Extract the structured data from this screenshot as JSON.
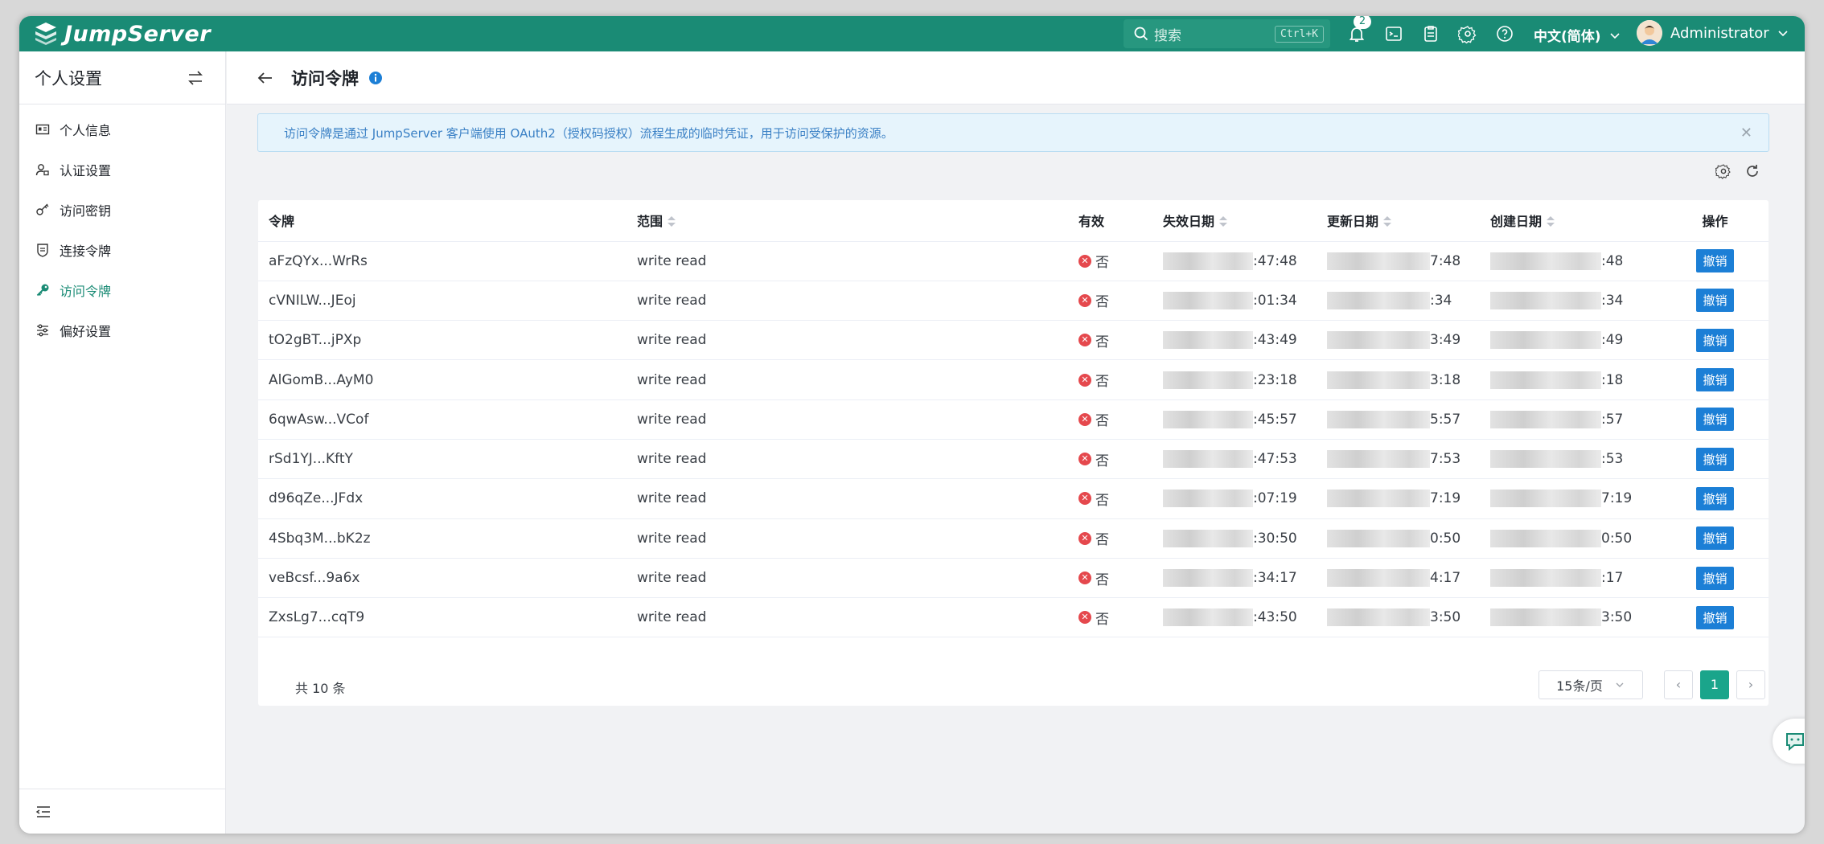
{
  "app": {
    "name": "JumpServer"
  },
  "topbar": {
    "search_placeholder": "搜索",
    "search_shortcut": "Ctrl+K",
    "notification_count": "2",
    "language": "中文(简体)",
    "username": "Administrator"
  },
  "sidebar": {
    "title": "个人设置",
    "items": [
      {
        "label": "个人信息",
        "icon": "id-card-icon"
      },
      {
        "label": "认证设置",
        "icon": "user-lock-icon"
      },
      {
        "label": "访问密钥",
        "icon": "key-icon"
      },
      {
        "label": "连接令牌",
        "icon": "shield-icon"
      },
      {
        "label": "访问令牌",
        "icon": "key-filled-icon",
        "active": true
      },
      {
        "label": "偏好设置",
        "icon": "sliders-icon"
      }
    ]
  },
  "main": {
    "title": "访问令牌",
    "alert": "访问令牌是通过 JumpServer 客户端使用 OAuth2（授权码授权）流程生成的临时凭证，用于访问受保护的资源。"
  },
  "table": {
    "columns": [
      "令牌",
      "范围",
      "有效",
      "失效日期",
      "更新日期",
      "创建日期",
      "操作"
    ],
    "rows": [
      {
        "token": "aFzQYx...WrRs",
        "scope": "write read",
        "valid": "否",
        "expires": ":47:48",
        "updated": "7:48",
        "created": ":48",
        "action": "撤销"
      },
      {
        "token": "cVNILW...JEoj",
        "scope": "write read",
        "valid": "否",
        "expires": ":01:34",
        "updated": ":34",
        "created": ":34",
        "action": "撤销"
      },
      {
        "token": "tO2gBT...jPXp",
        "scope": "write read",
        "valid": "否",
        "expires": ":43:49",
        "updated": "3:49",
        "created": ":49",
        "action": "撤销"
      },
      {
        "token": "AlGomB...AyM0",
        "scope": "write read",
        "valid": "否",
        "expires": ":23:18",
        "updated": "3:18",
        "created": ":18",
        "action": "撤销"
      },
      {
        "token": "6qwAsw...VCof",
        "scope": "write read",
        "valid": "否",
        "expires": ":45:57",
        "updated": "5:57",
        "created": ":57",
        "action": "撤销"
      },
      {
        "token": "rSd1YJ...KftY",
        "scope": "write read",
        "valid": "否",
        "expires": ":47:53",
        "updated": "7:53",
        "created": ":53",
        "action": "撤销"
      },
      {
        "token": "d96qZe...JFdx",
        "scope": "write read",
        "valid": "否",
        "expires": ":07:19",
        "updated": "7:19",
        "created": "7:19",
        "action": "撤销"
      },
      {
        "token": "4Sbq3M...bK2z",
        "scope": "write read",
        "valid": "否",
        "expires": ":30:50",
        "updated": "0:50",
        "created": "0:50",
        "action": "撤销"
      },
      {
        "token": "veBcsf...9a6x",
        "scope": "write read",
        "valid": "否",
        "expires": ":34:17",
        "updated": "4:17",
        "created": ":17",
        "action": "撤销"
      },
      {
        "token": "ZxsLg7...cqT9",
        "scope": "write read",
        "valid": "否",
        "expires": ":43:50",
        "updated": "3:50",
        "created": "3:50",
        "action": "撤销"
      }
    ]
  },
  "pagination": {
    "total": "共 10 条",
    "page_size": "15条/页",
    "current_page": "1"
  }
}
